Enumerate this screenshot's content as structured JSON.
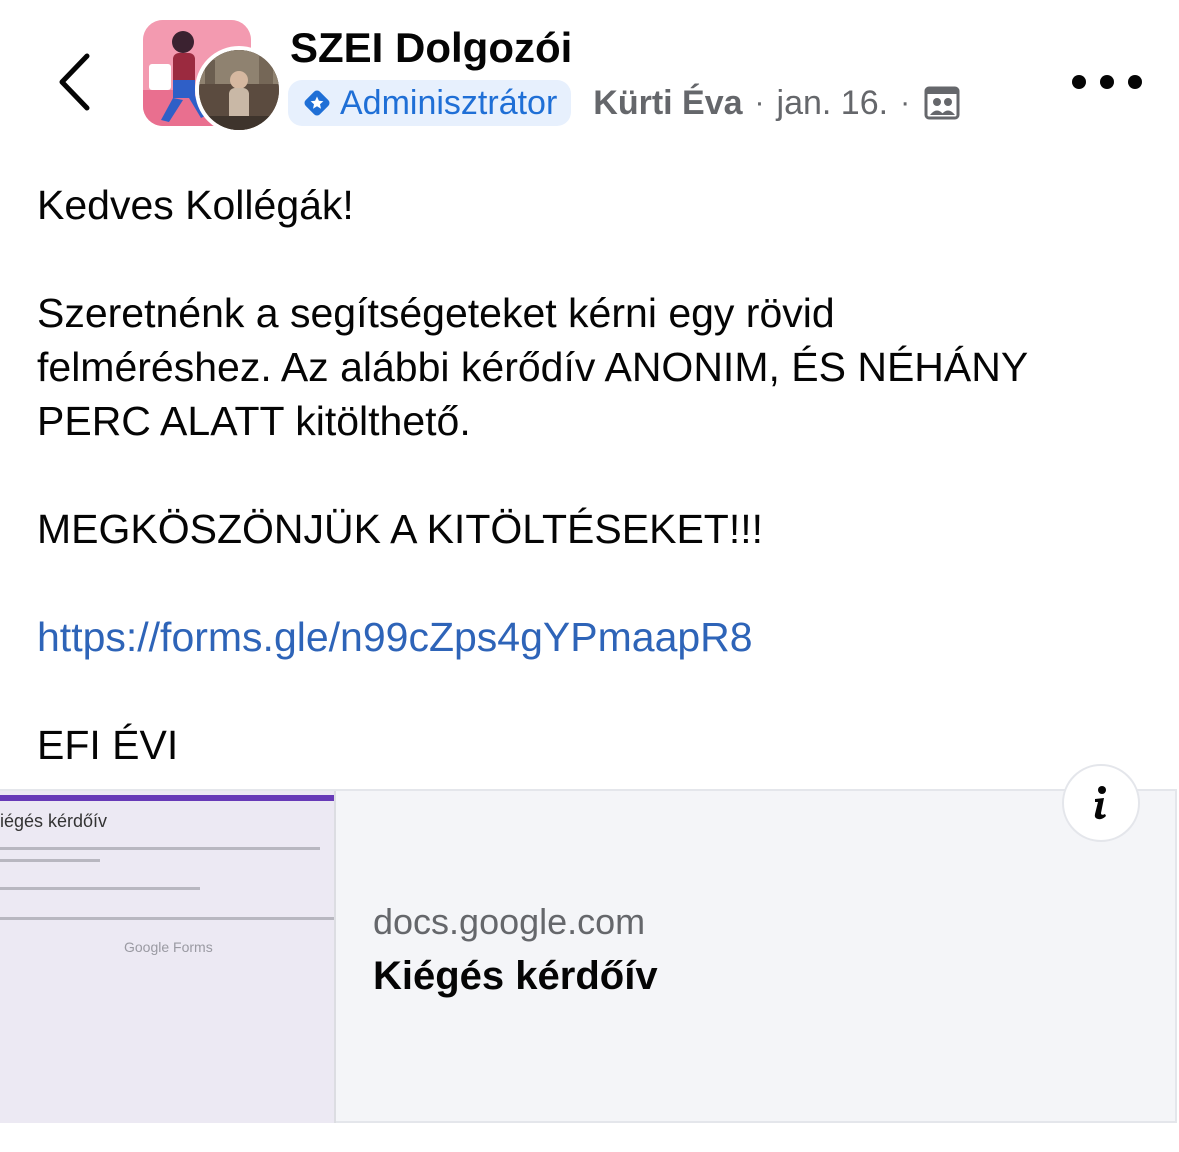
{
  "header": {
    "back_icon": "chevron-left-icon",
    "group_name": "SZEI Dolgozói",
    "badge_icon": "admin-star-icon",
    "badge_label": "Adminisztrátor",
    "author": "Kürti Éva",
    "separator": "·",
    "date": "jan. 16.",
    "privacy_icon": "group-members-icon",
    "more_icon": "more-horizontal-icon"
  },
  "post": {
    "greeting": "Kedves Kollégák!",
    "paragraph_line1": "Szeretnénk a segítségeteket kérni egy rövid",
    "paragraph_line2": "felméréshez. Az alábbi kérődív ANONIM, ÉS NÉHÁNY",
    "paragraph_line3": "PERC ALATT kitölthető.",
    "thanks": "MEGKÖSZÖNJÜK A KITÖLTÉSEKET!!!",
    "link": "https://forms.gle/n99cZps4gYPmaapR8",
    "signature": "EFI ÉVI"
  },
  "link_preview": {
    "thumbnail_title": "iégés kérdőív",
    "thumbnail_brand": "Google Forms",
    "domain": "docs.google.com",
    "title": "Kiégés kérdőív",
    "info_icon": "info-icon"
  },
  "colors": {
    "link": "#2e64b8",
    "badge_bg": "#e7f0fd",
    "badge_text": "#1f6fd6",
    "meta_text": "#65676b"
  }
}
